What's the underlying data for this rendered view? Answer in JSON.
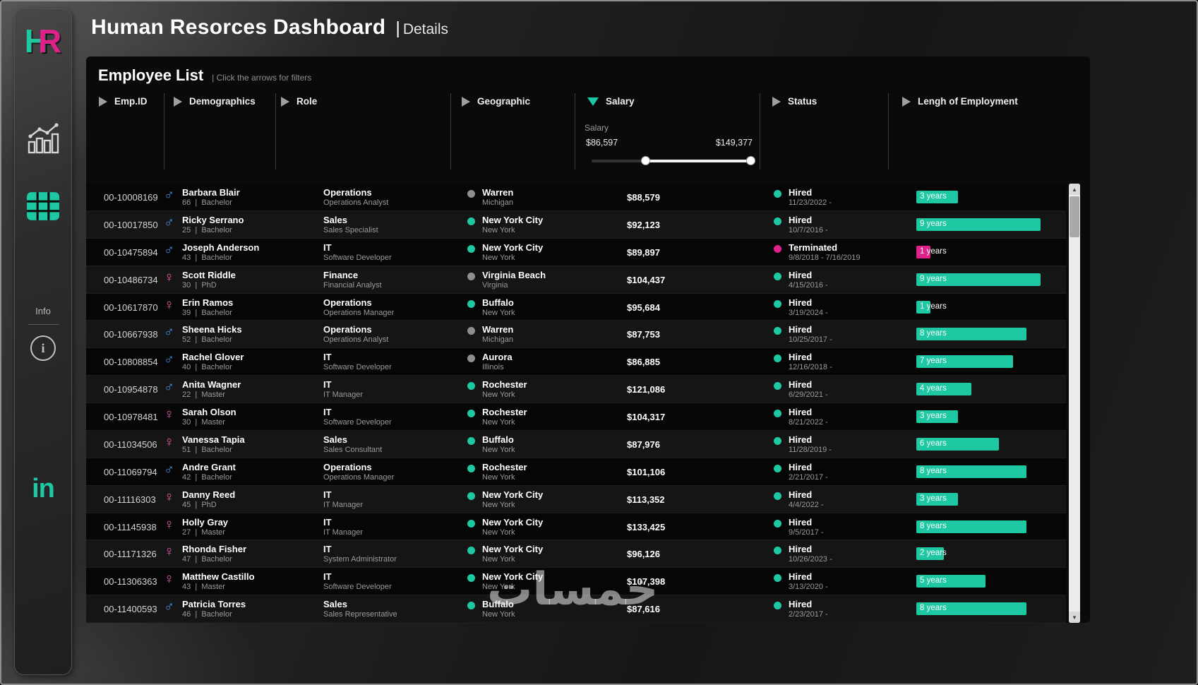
{
  "colors": {
    "teal": "#1dc8a2",
    "pink": "#e0218a",
    "male_blue": "#4a8fdd",
    "female_pink": "#e45cac",
    "gray_dot": "#8f8f8f"
  },
  "sidebar": {
    "logo_h": "H",
    "logo_r": "R",
    "info_label": "Info",
    "info_icon_glyph": "i",
    "linkedin_label": "in"
  },
  "header": {
    "title": "Human Resorces Dashboard",
    "pipe": "|",
    "subtitle": "Details"
  },
  "panel": {
    "title": "Employee List",
    "subtitle": "|  Click the arrows for filters"
  },
  "filters": [
    {
      "label": "Emp.ID"
    },
    {
      "label": "Demographics"
    },
    {
      "label": "Role"
    },
    {
      "label": "Geographic"
    },
    {
      "label": "Salary"
    },
    {
      "label": "Status"
    },
    {
      "label": "Lengh of Employment"
    }
  ],
  "salary_filter": {
    "label": "Salary",
    "min_value": "$86,597",
    "max_value": "$149,377"
  },
  "scrollbar": {
    "up": "▲",
    "down": "▼"
  },
  "icons": {
    "male": "♂",
    "female": "♀"
  },
  "watermark": "خمسات",
  "employees": [
    {
      "id": "00-10008169",
      "gender": "male",
      "name": "Barbara Blair",
      "age": "66",
      "degree": "Bachelor",
      "department": "Operations",
      "role": "Operations Analyst",
      "city": "Warren",
      "state": "Michigan",
      "location_dot": "gray",
      "salary": "$88,579",
      "status": "Hired",
      "dates": "11/23/2022 -",
      "years": 3,
      "years_label": "3 years"
    },
    {
      "id": "00-10017850",
      "gender": "male",
      "name": "Ricky Serrano",
      "age": "25",
      "degree": "Bachelor",
      "department": "Sales",
      "role": "Sales Specialist",
      "city": "New York City",
      "state": "New York",
      "location_dot": "teal",
      "salary": "$92,123",
      "status": "Hired",
      "dates": "10/7/2016 -",
      "years": 9,
      "years_label": "9 years"
    },
    {
      "id": "00-10475894",
      "gender": "male",
      "name": "Joseph Anderson",
      "age": "43",
      "degree": "Bachelor",
      "department": "IT",
      "role": "Software Developer",
      "city": "New York City",
      "state": "New York",
      "location_dot": "teal",
      "salary": "$89,897",
      "status": "Terminated",
      "dates": "9/8/2018 - 7/16/2019",
      "years": 1,
      "years_label": "1 years"
    },
    {
      "id": "00-10486734",
      "gender": "female",
      "name": "Scott Riddle",
      "age": "30",
      "degree": "PhD",
      "department": "Finance",
      "role": "Financial Analyst",
      "city": "Virginia Beach",
      "state": "Virginia",
      "location_dot": "gray",
      "salary": "$104,437",
      "status": "Hired",
      "dates": "4/15/2016 -",
      "years": 9,
      "years_label": "9 years"
    },
    {
      "id": "00-10617870",
      "gender": "female",
      "name": "Erin Ramos",
      "age": "39",
      "degree": "Bachelor",
      "department": "Operations",
      "role": "Operations Manager",
      "city": "Buffalo",
      "state": "New York",
      "location_dot": "teal",
      "salary": "$95,684",
      "status": "Hired",
      "dates": "3/19/2024 -",
      "years": 1,
      "years_label": "1 years"
    },
    {
      "id": "00-10667938",
      "gender": "male",
      "name": "Sheena Hicks",
      "age": "52",
      "degree": "Bachelor",
      "department": "Operations",
      "role": "Operations Analyst",
      "city": "Warren",
      "state": "Michigan",
      "location_dot": "gray",
      "salary": "$87,753",
      "status": "Hired",
      "dates": "10/25/2017 -",
      "years": 8,
      "years_label": "8 years"
    },
    {
      "id": "00-10808854",
      "gender": "male",
      "name": "Rachel Glover",
      "age": "40",
      "degree": "Bachelor",
      "department": "IT",
      "role": "Software Developer",
      "city": "Aurora",
      "state": "Illinois",
      "location_dot": "gray",
      "salary": "$86,885",
      "status": "Hired",
      "dates": "12/16/2018 -",
      "years": 7,
      "years_label": "7 years"
    },
    {
      "id": "00-10954878",
      "gender": "male",
      "name": "Anita Wagner",
      "age": "22",
      "degree": "Master",
      "department": "IT",
      "role": "IT Manager",
      "city": "Rochester",
      "state": "New York",
      "location_dot": "teal",
      "salary": "$121,086",
      "status": "Hired",
      "dates": "6/29/2021 -",
      "years": 4,
      "years_label": "4 years"
    },
    {
      "id": "00-10978481",
      "gender": "female",
      "name": "Sarah Olson",
      "age": "30",
      "degree": "Master",
      "department": "IT",
      "role": "Software Developer",
      "city": "Rochester",
      "state": "New York",
      "location_dot": "teal",
      "salary": "$104,317",
      "status": "Hired",
      "dates": "8/21/2022 -",
      "years": 3,
      "years_label": "3 years"
    },
    {
      "id": "00-11034506",
      "gender": "female",
      "name": "Vanessa Tapia",
      "age": "51",
      "degree": "Bachelor",
      "department": "Sales",
      "role": "Sales Consultant",
      "city": "Buffalo",
      "state": "New York",
      "location_dot": "teal",
      "salary": "$87,976",
      "status": "Hired",
      "dates": "11/28/2019 -",
      "years": 6,
      "years_label": "6 years"
    },
    {
      "id": "00-11069794",
      "gender": "male",
      "name": "Andre Grant",
      "age": "42",
      "degree": "Bachelor",
      "department": "Operations",
      "role": "Operations Manager",
      "city": "Rochester",
      "state": "New York",
      "location_dot": "teal",
      "salary": "$101,106",
      "status": "Hired",
      "dates": "2/21/2017 -",
      "years": 8,
      "years_label": "8 years"
    },
    {
      "id": "00-11116303",
      "gender": "female",
      "name": "Danny Reed",
      "age": "45",
      "degree": "PhD",
      "department": "IT",
      "role": "IT Manager",
      "city": "New York City",
      "state": "New York",
      "location_dot": "teal",
      "salary": "$113,352",
      "status": "Hired",
      "dates": "4/4/2022 -",
      "years": 3,
      "years_label": "3 years"
    },
    {
      "id": "00-11145938",
      "gender": "female",
      "name": "Holly Gray",
      "age": "27",
      "degree": "Master",
      "department": "IT",
      "role": "IT Manager",
      "city": "New York City",
      "state": "New York",
      "location_dot": "teal",
      "salary": "$133,425",
      "status": "Hired",
      "dates": "9/5/2017 -",
      "years": 8,
      "years_label": "8 years"
    },
    {
      "id": "00-11171326",
      "gender": "female",
      "name": "Rhonda Fisher",
      "age": "47",
      "degree": "Bachelor",
      "department": "IT",
      "role": "System Administrator",
      "city": "New York City",
      "state": "New York",
      "location_dot": "teal",
      "salary": "$96,126",
      "status": "Hired",
      "dates": "10/26/2023 -",
      "years": 2,
      "years_label": "2 years"
    },
    {
      "id": "00-11306363",
      "gender": "female",
      "name": "Matthew Castillo",
      "age": "43",
      "degree": "Master",
      "department": "IT",
      "role": "Software Developer",
      "city": "New York City",
      "state": "New York",
      "location_dot": "teal",
      "salary": "$107,398",
      "status": "Hired",
      "dates": "3/13/2020 -",
      "years": 5,
      "years_label": "5 years"
    },
    {
      "id": "00-11400593",
      "gender": "male",
      "name": "Patricia Torres",
      "age": "46",
      "degree": "Bachelor",
      "department": "Sales",
      "role": "Sales Representative",
      "city": "Buffalo",
      "state": "New York",
      "location_dot": "teal",
      "salary": "$87,616",
      "status": "Hired",
      "dates": "2/23/2017 -",
      "years": 8,
      "years_label": "8 years"
    }
  ]
}
